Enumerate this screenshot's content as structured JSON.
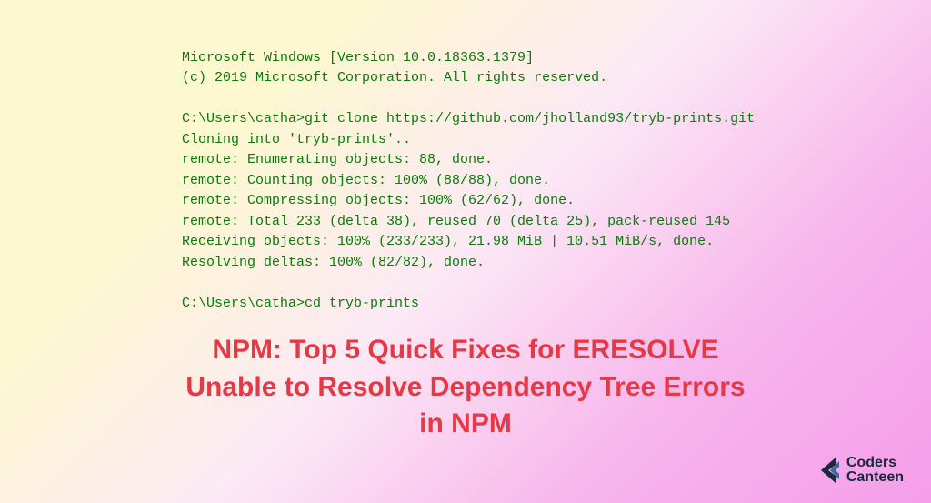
{
  "terminal": {
    "line1": "Microsoft Windows [Version 10.0.18363.1379]",
    "line2": "(c) 2019 Microsoft Corporation. All rights reserved.",
    "blank1": "",
    "line3": "C:\\Users\\catha>git clone https://github.com/jholland93/tryb-prints.git",
    "line4": "Cloning into 'tryb-prints'..",
    "line5": "remote: Enumerating objects: 88, done.",
    "line6": "remote: Counting objects: 100% (88/88), done.",
    "line7": "remote: Compressing objects: 100% (62/62), done.",
    "line8": "remote: Total 233 (delta 38), reused 70 (delta 25), pack-reused 145",
    "line9": "Receiving objects: 100% (233/233), 21.98 MiB | 10.51 MiB/s, done.",
    "line10": "Resolving deltas: 100% (82/82), done.",
    "blank2": "",
    "line11": "C:\\Users\\catha>cd tryb-prints"
  },
  "headline": {
    "line1": "NPM: Top 5 Quick Fixes for ERESOLVE",
    "line2": "Unable to Resolve Dependency Tree Errors",
    "line3": "in NPM"
  },
  "logo": {
    "word1": "Coders",
    "word2": "Canteen"
  },
  "colors": {
    "terminal_text": "#0a7a0a",
    "headline_text": "#e63946",
    "logo_text": "#1a2a3a"
  }
}
